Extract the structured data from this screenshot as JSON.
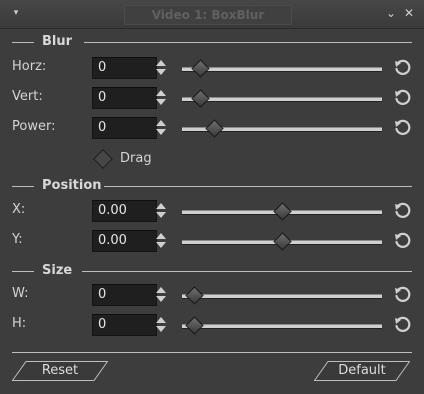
{
  "window": {
    "title": "Video 1: BoxBlur",
    "menu_glyph": "▾",
    "minimize_glyph": "⌄",
    "close_glyph": "✕"
  },
  "sections": {
    "blur": "Blur",
    "position": "Position",
    "size": "Size"
  },
  "rows": [
    {
      "label": "Horz:",
      "value": "0",
      "slider_fraction": 0.09
    },
    {
      "label": "Vert:",
      "value": "0",
      "slider_fraction": 0.09
    },
    {
      "label": "Power:",
      "value": "0",
      "slider_fraction": 0.16
    },
    {
      "label": "X:",
      "value": "0.00",
      "slider_fraction": 0.5
    },
    {
      "label": "Y:",
      "value": "0.00",
      "slider_fraction": 0.5
    },
    {
      "label": "W:",
      "value": "0",
      "slider_fraction": 0.06
    },
    {
      "label": "H:",
      "value": "0",
      "slider_fraction": 0.06
    }
  ],
  "drag": {
    "label": "Drag"
  },
  "buttons": {
    "reset": "Reset",
    "default": "Default"
  },
  "icons": {
    "menu": "menu-arrow-icon",
    "reset": "undo-reset-icon",
    "spin": "spin-arrows-icon",
    "drag": "diamond-toggle-icon"
  }
}
